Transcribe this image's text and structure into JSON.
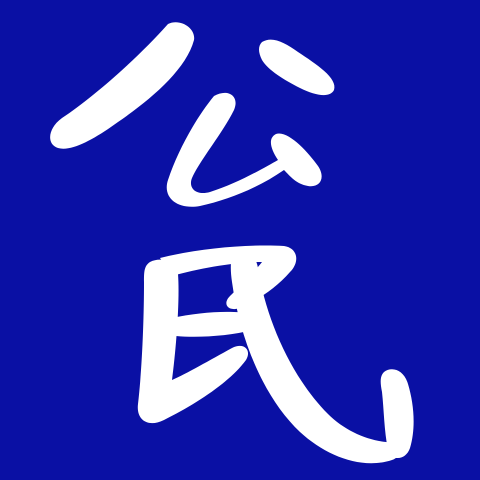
{
  "logo": {
    "characters": [
      "公",
      "民"
    ],
    "text": "公民",
    "background_color": "#0a10a4",
    "ink_color": "#ffffff"
  }
}
